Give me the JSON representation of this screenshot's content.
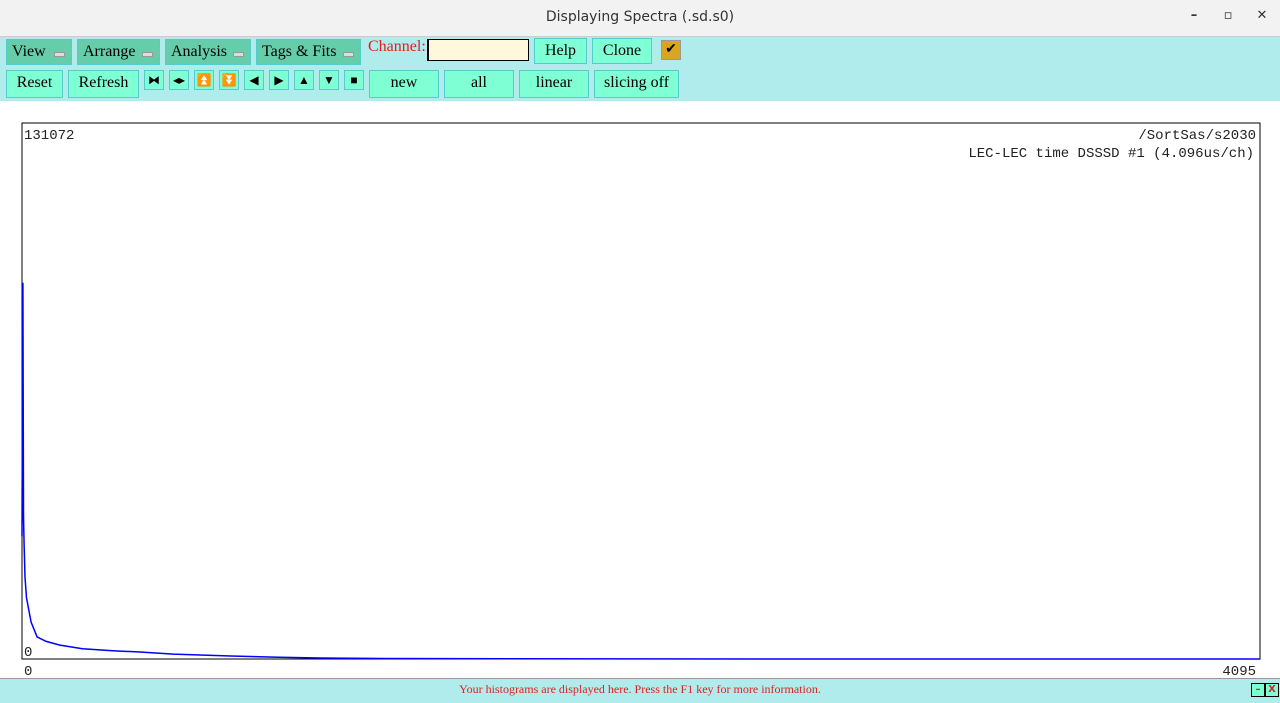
{
  "window": {
    "title": "Displaying Spectra (.sd.s0)",
    "minimize": "–",
    "maximize": "▫",
    "close": "✕"
  },
  "toolbar": {
    "menus": [
      "View",
      "Arrange",
      "Analysis",
      "Tags & Fits"
    ],
    "channel_label": "Channel:",
    "channel_value": "",
    "help": "Help",
    "clone": "Clone",
    "checkbox": "✔",
    "reset": "Reset",
    "refresh": "Refresh",
    "icons": [
      "⧓",
      "◂▸",
      "⏫",
      "⏬",
      "◀",
      "▶",
      "▲",
      "▼",
      "■"
    ],
    "new": "new",
    "all": "all",
    "linear": "linear",
    "slicing": "slicing off"
  },
  "chart_data": {
    "type": "line",
    "title": "/SortSas/s2030",
    "subtitle": "LEC-LEC time DSSSD #1 (4.096us/ch)",
    "xlim": [
      0,
      4095
    ],
    "ylim": [
      0,
      131072
    ],
    "x_tick_labels": [
      "0",
      "4095"
    ],
    "y_tick_labels": [
      "0",
      "131072"
    ],
    "color": "#0000ff",
    "x": [
      0,
      3,
      5,
      7,
      10,
      15,
      20,
      30,
      50,
      80,
      125,
      200,
      300,
      390,
      500,
      690,
      850,
      985,
      1200,
      1600,
      2000,
      3000,
      4095
    ],
    "y": [
      30000,
      92000,
      35000,
      28000,
      20000,
      15000,
      13000,
      9000,
      5400,
      4300,
      3400,
      2500,
      2000,
      1700,
      1200,
      730,
      450,
      240,
      120,
      50,
      20,
      5,
      0
    ]
  },
  "status": {
    "message": "Your histograms are displayed here. Press the F1 key for more information.",
    "min": "–",
    "close": "X"
  }
}
